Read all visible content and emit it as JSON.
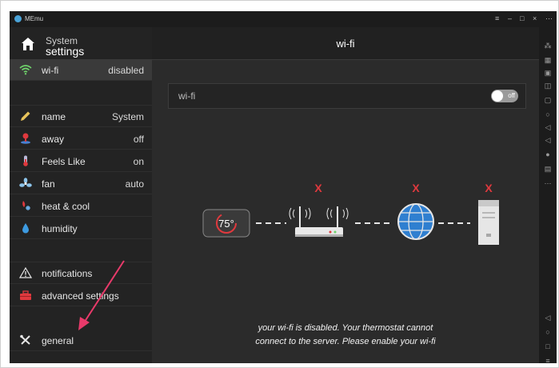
{
  "window": {
    "title": "MEmu",
    "controls": [
      "≡",
      "–",
      "□",
      "×",
      "⋯"
    ]
  },
  "sidebar": {
    "title_line1": "System",
    "title_line2": "settings",
    "wifi": {
      "label": "wi-fi",
      "value": "disabled",
      "icon": "wifi-icon"
    },
    "items": [
      {
        "label": "name",
        "value": "System",
        "icon": "pencil-icon"
      },
      {
        "label": "away",
        "value": "off",
        "icon": "away-person-icon"
      },
      {
        "label": "Feels Like",
        "value": "on",
        "icon": "thermometer-icon"
      },
      {
        "label": "fan",
        "value": "auto",
        "icon": "fan-icon"
      },
      {
        "label": "heat & cool",
        "value": "",
        "icon": "heat-cool-icon"
      },
      {
        "label": "humidity",
        "value": "",
        "icon": "water-drop-icon"
      }
    ],
    "notifications": {
      "label": "notifications",
      "icon": "warning-triangle-icon"
    },
    "advanced": {
      "label": "advanced settings",
      "icon": "toolbox-icon"
    },
    "general": {
      "label": "general",
      "icon": "tools-icon"
    }
  },
  "main": {
    "title": "wi-fi",
    "wifi_toggle": {
      "label": "wi-fi",
      "state_text": "off"
    },
    "diagram": {
      "thermostat_temp": "75°",
      "x_mark": "X",
      "icons": [
        "thermostat-icon",
        "router-icon",
        "globe-icon",
        "server-icon"
      ]
    },
    "message_line1": "your wi-fi is disabled. Your thermostat cannot",
    "message_line2": "connect to the server. Please enable your wi-fi"
  },
  "colors": {
    "accent_green": "#6fd36b",
    "error_red": "#e0393e",
    "annotation_arrow": "#e83a6a",
    "globe_blue": "#2f7fd0"
  }
}
